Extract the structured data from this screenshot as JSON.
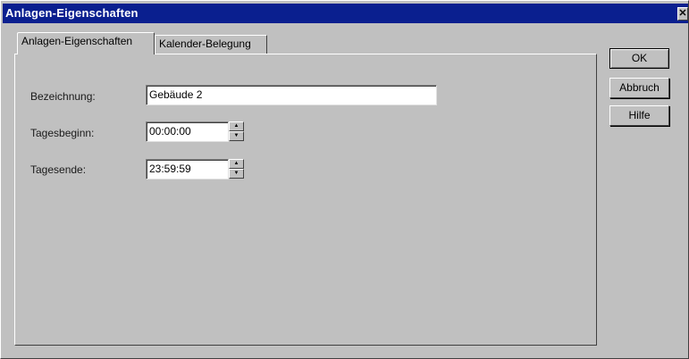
{
  "window": {
    "title": "Anlagen-Eigenschaften",
    "close_glyph": "✕"
  },
  "tabs": [
    {
      "label": "Anlagen-Eigenschaften",
      "active": true
    },
    {
      "label": "Kalender-Belegung",
      "active": false
    }
  ],
  "form": {
    "bezeichnung": {
      "label": "Bezeichnung:",
      "value": "Gebäude 2"
    },
    "tagesbeginn": {
      "label": "Tagesbeginn:",
      "value": "00:00:00"
    },
    "tagesende": {
      "label": "Tagesende:",
      "value": "23:59:59"
    }
  },
  "buttons": {
    "ok": "OK",
    "abbruch": "Abbruch",
    "hilfe": "Hilfe"
  },
  "icons": {
    "close": "close-icon",
    "spin_up": "spin-up-icon",
    "spin_down": "spin-down-icon"
  }
}
